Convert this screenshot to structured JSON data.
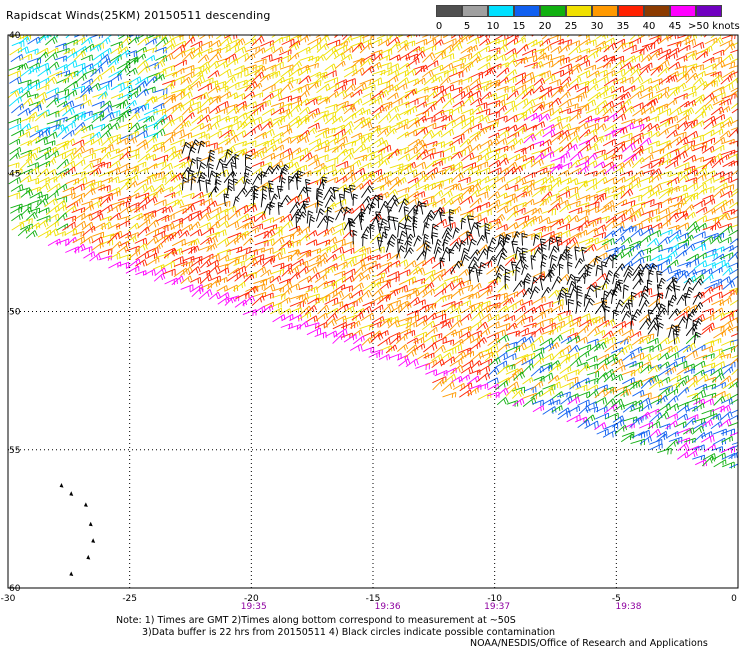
{
  "header": {
    "title": "Rapidscat Winds(25KM) 20150511 descending"
  },
  "color_scale": {
    "labels": [
      "0",
      "5",
      "10",
      "15",
      "20",
      "25",
      "30",
      "35",
      "40",
      "45"
    ],
    "last_label": ">50 knots",
    "colors": [
      "#505050",
      "#a0a0a0",
      "#00e0ff",
      "#1060f0",
      "#10b010",
      "#f0e000",
      "#ff9900",
      "#ff2000",
      "#8b3a00",
      "#ff00ff",
      "#7000c0"
    ],
    "black_barb_color": "#000000"
  },
  "map": {
    "x_ticks": [
      "-30",
      "-25",
      "-20",
      "-15",
      "-10",
      "-5",
      "0"
    ],
    "y_ticks": [
      "40",
      "45",
      "50",
      "55",
      "60"
    ],
    "lon_range": [
      -30,
      0
    ],
    "lat_range": [
      40,
      60
    ],
    "time_labels": [
      "19:35",
      "19:36",
      "19:37",
      "19:38"
    ],
    "time_label_lons": [
      -19.9,
      -14.4,
      -9.9,
      -4.5
    ],
    "grid": "dotted",
    "land_symbol_lonlat": [
      [
        -27.6,
        55.0
      ],
      [
        -27.7,
        55.3
      ]
    ],
    "islands_lonlat": [
      [
        -27.8,
        56.3
      ],
      [
        -27.4,
        56.6
      ],
      [
        -26.8,
        57.0
      ],
      [
        -26.6,
        57.7
      ],
      [
        -26.5,
        58.3
      ],
      [
        -26.7,
        58.9
      ],
      [
        -27.4,
        59.5
      ]
    ]
  },
  "notes": {
    "line1": "Note: 1) Times are GMT 2)Times along bottom correspond to measurement at ~50S",
    "line2": "3)Data buffer is 22 hrs from 20150511 4) Black circles indicate possible contamination",
    "line3": "NOAA/NESDIS/Office of Research and Applications"
  }
}
